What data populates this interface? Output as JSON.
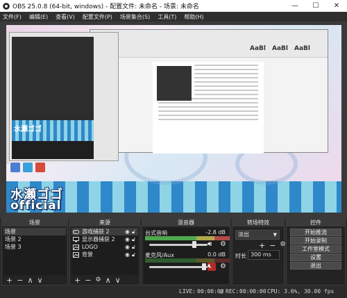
{
  "window": {
    "title": "OBS 25.0.8 (64-bit, windows) - 配置文件: 未命名 - 场景: 未命名",
    "minimize": "—",
    "maximize": "☐",
    "close": "✕"
  },
  "menu": [
    "文件(F)",
    "编辑(E)",
    "查看(V)",
    "配置文件(P)",
    "场景集合(S)",
    "工具(T)",
    "帮助(H)"
  ],
  "preview": {
    "brand_line1": "水瀬ゴゴ",
    "brand_line2": "official",
    "doc_ribbon_text": [
      "AaBl",
      "AaBl",
      "AaBl"
    ]
  },
  "docks": {
    "scenes": {
      "header": "场景",
      "items": [
        "场景",
        "场景 2",
        "场景 3"
      ],
      "active_index": 0
    },
    "sources": {
      "header": "来源",
      "items": [
        {
          "label": "游戏捕获 2",
          "icon": "gamepad-icon"
        },
        {
          "label": "显示器捕获 2",
          "icon": "monitor-icon"
        },
        {
          "label": "LOGO",
          "icon": "image-icon"
        },
        {
          "label": "背景",
          "icon": "image-icon"
        }
      ],
      "active_index": 0
    },
    "mixer": {
      "header": "混音器",
      "tracks": [
        {
          "name": "台式音响",
          "db": "-2.8 dB",
          "muted": false
        },
        {
          "name": "麦克风/Aux",
          "db": "0.0 dB",
          "muted": true
        }
      ]
    },
    "transitions": {
      "header": "转场特效",
      "selected": "淡出",
      "duration_label": "时长",
      "duration_value": "300 ms"
    },
    "controls": {
      "header": "控件",
      "buttons": [
        "开始推流",
        "开始录制",
        "工作室模式",
        "设置",
        "退出"
      ]
    }
  },
  "status": {
    "live_label": "LIVE:",
    "live_time": "00:00:00",
    "rec_label": "REC:",
    "rec_time": "00:00:00",
    "cpu": "CPU: 3.6%, 30.00 fps"
  },
  "colors": {
    "background": "#2b2b2b",
    "stripe_dark": "#2f88c9",
    "stripe_light": "#8ed3e6",
    "meter_green": "#4ea84e",
    "mute_red": "#b12a2a"
  }
}
